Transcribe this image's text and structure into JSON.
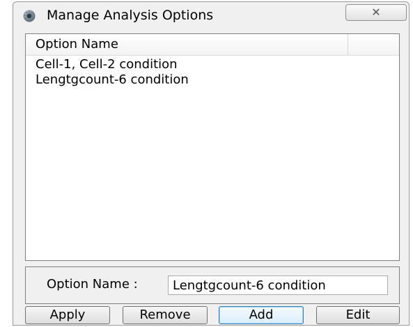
{
  "window": {
    "title": "Manage Analysis Options",
    "close_icon": "close-icon"
  },
  "list": {
    "column_header": "Option Name",
    "rows": [
      "Cell-1, Cell-2 condition",
      "Lengtgcount-6 condition"
    ]
  },
  "form": {
    "label": "Option Name :",
    "value": "Lengtgcount-6 condition"
  },
  "buttons": {
    "apply": "Apply",
    "remove": "Remove",
    "add": "Add",
    "edit": "Edit"
  },
  "colors": {
    "window_bg": "#f0f0f0",
    "default_button_border": "#3c7fb1"
  }
}
